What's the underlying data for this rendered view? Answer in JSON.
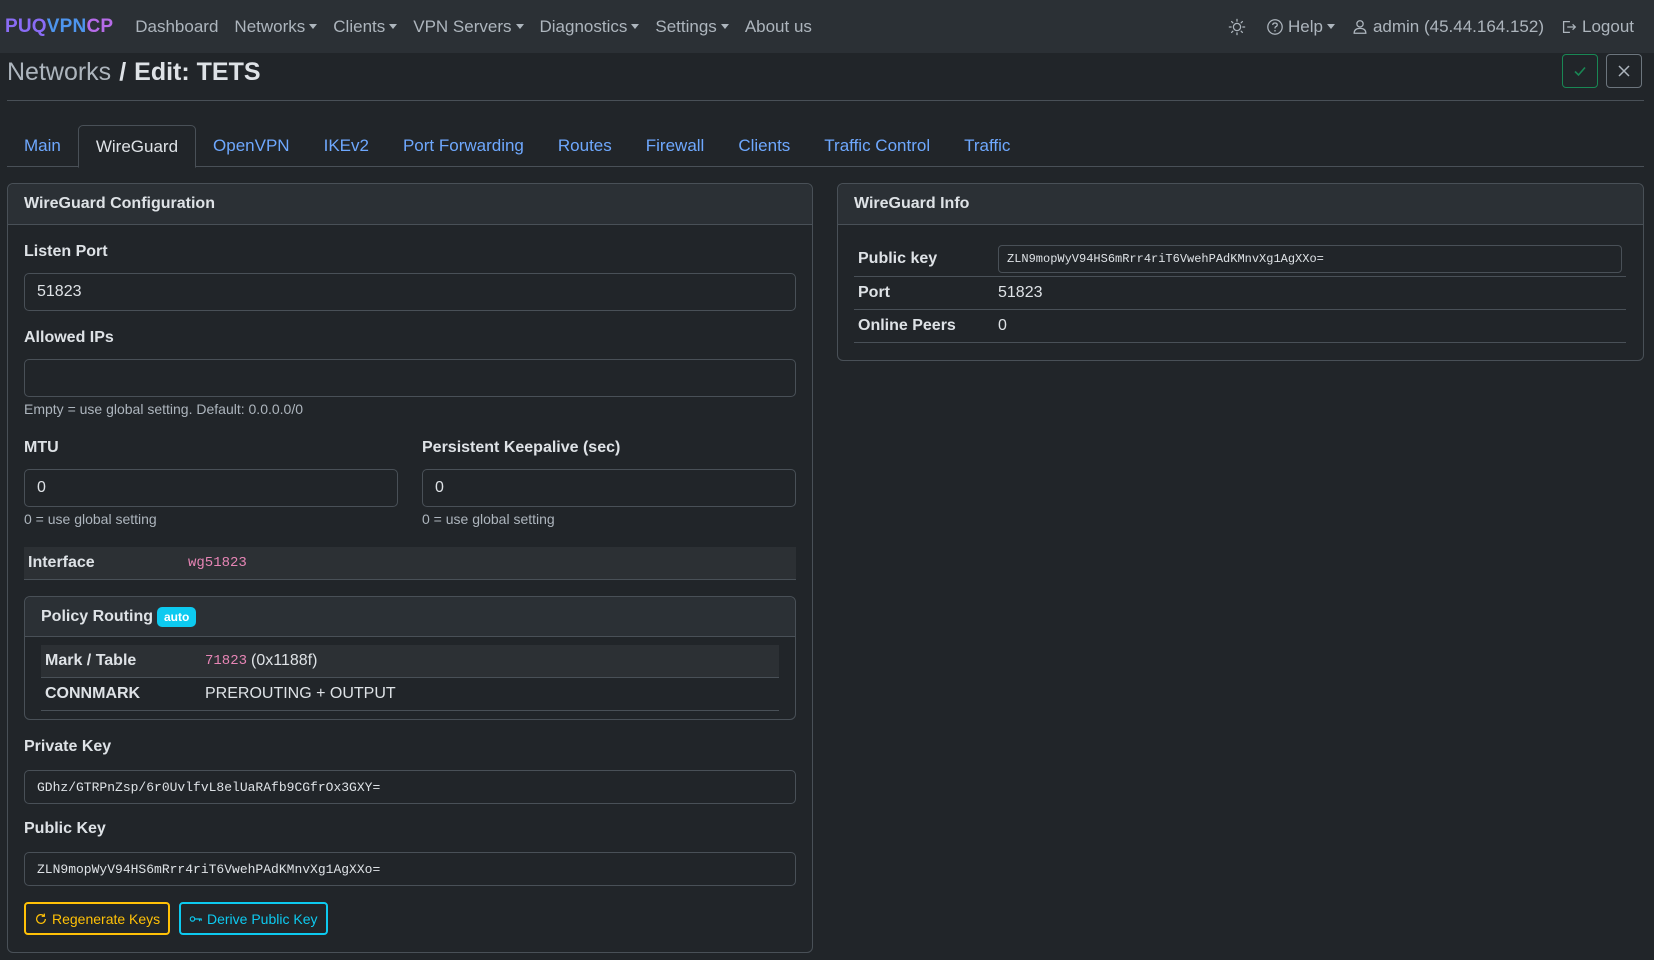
{
  "brand": {
    "part1": "PUQ",
    "part2": "VPN",
    "part3": "CP"
  },
  "nav": {
    "dashboard": "Dashboard",
    "networks": "Networks",
    "clients": "Clients",
    "vpn_servers": "VPN Servers",
    "diagnostics": "Diagnostics",
    "settings": "Settings",
    "about": "About us",
    "help": "Help",
    "user": "admin (45.44.164.152)",
    "logout": "Logout"
  },
  "page": {
    "crumb": "Networks",
    "separator": "/",
    "title": "Edit: TETS"
  },
  "tabs": [
    {
      "label": "Main"
    },
    {
      "label": "WireGuard"
    },
    {
      "label": "OpenVPN"
    },
    {
      "label": "IKEv2"
    },
    {
      "label": "Port Forwarding"
    },
    {
      "label": "Routes"
    },
    {
      "label": "Firewall"
    },
    {
      "label": "Clients"
    },
    {
      "label": "Traffic Control"
    },
    {
      "label": "Traffic"
    }
  ],
  "active_tab": "WireGuard",
  "config": {
    "title": "WireGuard Configuration",
    "listen_port_label": "Listen Port",
    "listen_port_value": "51823",
    "allowed_ips_label": "Allowed IPs",
    "allowed_ips_value": "",
    "allowed_ips_help": "Empty = use global setting. Default: 0.0.0.0/0",
    "mtu_label": "MTU",
    "mtu_value": "0",
    "mtu_help": "0 = use global setting",
    "keepalive_label": "Persistent Keepalive (sec)",
    "keepalive_value": "0",
    "keepalive_help": "0 = use global setting",
    "interface_label": "Interface",
    "interface_value": "wg51823",
    "policy_title": "Policy Routing",
    "policy_badge": "auto",
    "mark_label": "Mark / Table",
    "mark_code": "71823",
    "mark_hex": "(0x1188f)",
    "connmark_label": "CONNMARK",
    "connmark_value": "PREROUTING + OUTPUT",
    "private_key_label": "Private Key",
    "private_key_value": "GDhz/GTRPnZsp/6r0UvlfvL8elUaRAfb9CGfrOx3GXY=",
    "public_key_label": "Public Key",
    "public_key_value": "ZLN9mopWyV94HS6mRrr4riT6VwehPAdKMnvXg1AgXXo=",
    "regenerate_label": "Regenerate Keys",
    "derive_label": "Derive Public Key"
  },
  "info": {
    "title": "WireGuard Info",
    "public_key_label": "Public key",
    "public_key_value": "ZLN9mopWyV94HS6mRrr4riT6VwehPAdKMnvXg1AgXXo=",
    "port_label": "Port",
    "port_value": "51823",
    "peers_label": "Online Peers",
    "peers_value": "0"
  },
  "colors": {
    "accent": "#6ea8fe",
    "success": "#198754",
    "warning": "#ffc107",
    "info": "#0dcaf0",
    "code": "#e685b5"
  }
}
